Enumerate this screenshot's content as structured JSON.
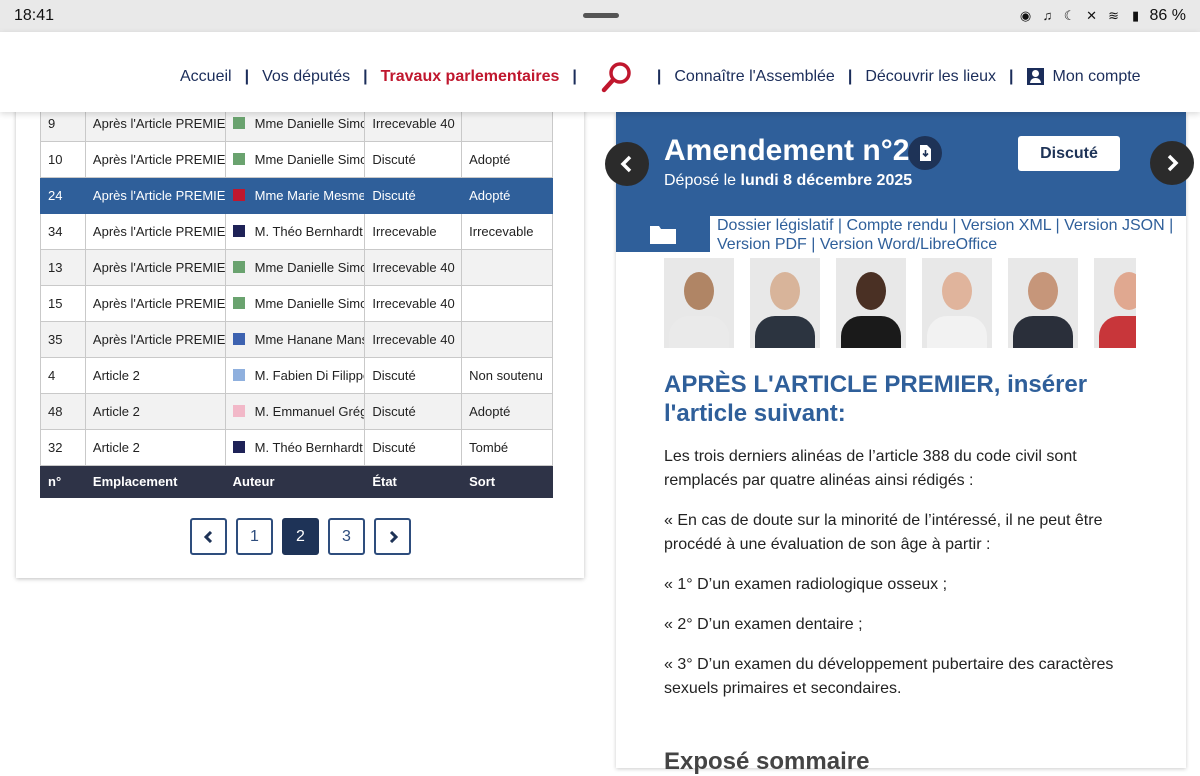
{
  "statusbar": {
    "time": "18:41",
    "battery": "86 %"
  },
  "nav": {
    "items": [
      "Accueil",
      "Vos députés",
      "Travaux parlementaires",
      "Connaître l'Assemblée",
      "Découvrir les lieux",
      "Mon compte"
    ]
  },
  "table": {
    "headers": [
      "n°",
      "Emplacement",
      "Auteur",
      "État",
      "Sort"
    ],
    "rows": [
      {
        "num": "9",
        "place": "Après l'Article PREMIER",
        "author": "Mme Danielle Simonnet",
        "color": "#6aa36f",
        "state": "Irrecevable 40",
        "sort": ""
      },
      {
        "num": "10",
        "place": "Après l'Article PREMIER",
        "author": "Mme Danielle Simonnet",
        "color": "#6aa36f",
        "state": "Discuté",
        "sort": "Adopté"
      },
      {
        "num": "24",
        "place": "Après l'Article PREMIER",
        "author": "Mme Marie Mesmeur",
        "color": "#c0172e",
        "state": "Discuté",
        "sort": "Adopté"
      },
      {
        "num": "34",
        "place": "Après l'Article PREMIER",
        "author": "M. Théo Bernhardt",
        "color": "#1e2257",
        "state": "Irrecevable",
        "sort": "Irrecevable"
      },
      {
        "num": "13",
        "place": "Après l'Article PREMIER",
        "author": "Mme Danielle Simonnet",
        "color": "#6aa36f",
        "state": "Irrecevable 40",
        "sort": ""
      },
      {
        "num": "15",
        "place": "Après l'Article PREMIER",
        "author": "Mme Danielle Simonnet",
        "color": "#6aa36f",
        "state": "Irrecevable 40",
        "sort": ""
      },
      {
        "num": "35",
        "place": "Après l'Article PREMIER",
        "author": "Mme Hanane Mansouri",
        "color": "#3d62b0",
        "state": "Irrecevable 40",
        "sort": ""
      },
      {
        "num": "4",
        "place": "Article 2",
        "author": "M. Fabien Di Filippo",
        "color": "#8fb0de",
        "state": "Discuté",
        "sort": "Non soutenu"
      },
      {
        "num": "48",
        "place": "Article 2",
        "author": "M. Emmanuel Grégoire",
        "color": "#f2b8c8",
        "state": "Discuté",
        "sort": "Adopté"
      },
      {
        "num": "32",
        "place": "Article 2",
        "author": "M. Théo Bernhardt",
        "color": "#1e2257",
        "state": "Discuté",
        "sort": "Tombé"
      }
    ],
    "selected_row": 2
  },
  "pager": {
    "pages": [
      "1",
      "2",
      "3"
    ],
    "current": "2"
  },
  "amendment": {
    "title": "Amendement n°24",
    "deposit_prefix": "Déposé le ",
    "deposit_date": "lundi 8 décembre 2025",
    "status_button": "Discuté",
    "links_line1": "Dossier législatif | Compte rendu | Version XML | Version JSON |",
    "links_line2": "Version PDF | Version Word/LibreOffice",
    "article_title": "APRÈS L'ARTICLE PREMIER, insérer l'article suivant:",
    "paragraphs": [
      "Les trois derniers alinéas de l’article 388 du code civil sont remplacés par quatre alinéas ainsi rédigés :",
      "« En cas de doute sur la minorité de l’intéressé, il ne peut être procédé à une évaluation de son âge à partir :",
      "« 1° D’un examen radiologique osseux ;",
      "« 2° D’un examen dentaire ;",
      "« 3° D’un examen du développement pubertaire des caractères sexuels primaires et secondaires."
    ],
    "expose_title": "Exposé sommaire"
  },
  "colors": {
    "navy": "#1b2d5a",
    "accent_red": "#c0172e",
    "header_blue": "#2f5f9a",
    "table_head": "#2e3347"
  }
}
